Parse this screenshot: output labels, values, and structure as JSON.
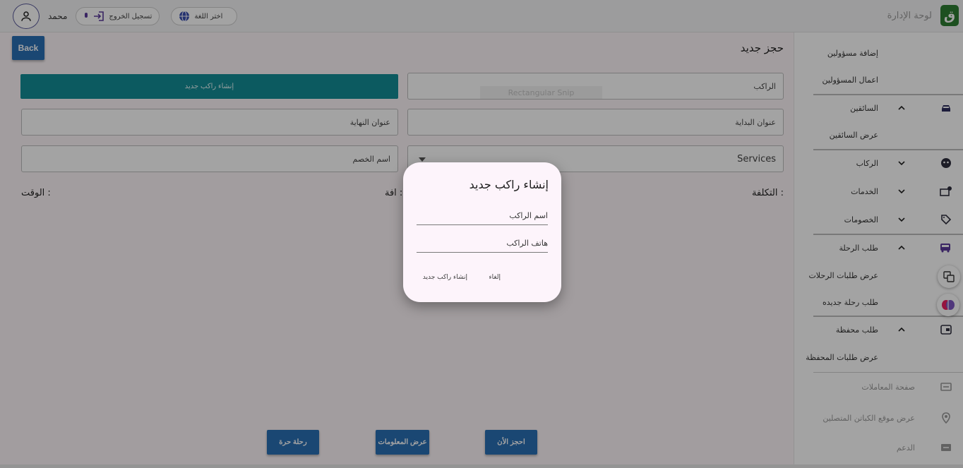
{
  "header": {
    "brand_title": "لوحة الإدارة",
    "brand_logo_text": "ق",
    "username": "محمد",
    "logout_label": "تسجيل الخروج",
    "language_label": "اختر اللغة"
  },
  "page": {
    "title": "حجز جديد",
    "back_label": "Back",
    "create_rider_label": "إنشاء راكب جديد",
    "snip_overlay_text": "Rectangular Snip",
    "fields": {
      "rider": "الراكب",
      "start_address": "عنوان البداية",
      "end_address": "عنوان النهاية",
      "services": "Services",
      "discount_name": "اسم الخصم"
    },
    "info": {
      "cost": "التكلفة :",
      "distance": "افة :",
      "time": "الوقت :"
    },
    "actions": {
      "book_now": "احجز الأن",
      "show_info": "عرض المعلومات",
      "free_trip": "رحلة حرة"
    }
  },
  "sidebar": {
    "items": [
      {
        "label": "إضافة مسؤولين"
      },
      {
        "label": "اعمال المسؤولين"
      },
      {
        "label": "السائقين",
        "icon": "car-icon",
        "expanded": true
      },
      {
        "label": "عرض السائقين"
      },
      {
        "label": "الركاب",
        "icon": "face-icon",
        "expanded": false
      },
      {
        "label": "الخدمات",
        "icon": "services-icon",
        "expanded": false
      },
      {
        "label": "الخصومات",
        "icon": "tag-icon",
        "expanded": false
      },
      {
        "label": "طلب الرحلة",
        "icon": "bus-icon",
        "expanded": true
      },
      {
        "label": "عرض طلبات الرحلات"
      },
      {
        "label": "طلب رحلة جديده"
      },
      {
        "label": "طلب محفظة",
        "icon": "wallet-icon",
        "expanded": true
      },
      {
        "label": "عرض طلبات المحفظة"
      },
      {
        "label": "صفحة المعاملات",
        "icon": "transactions-icon"
      },
      {
        "label": "عرض موقع الكباتن المتصلين",
        "icon": "location-icon"
      },
      {
        "label": "الدعم",
        "icon": "support-icon"
      }
    ]
  },
  "dialog": {
    "title": "إنشاء راكب جديد",
    "rider_name_placeholder": "اسم الراكب",
    "rider_phone_placeholder": "هاتف الراكب",
    "cancel_label": "إلغاء",
    "create_label": "إنشاء راكب جديد"
  },
  "colors": {
    "primary_button": "#2a6fb4",
    "teal_button": "#138d96",
    "brand_logo": "#2e7d32",
    "icon_purple": "#5b3a9b"
  }
}
